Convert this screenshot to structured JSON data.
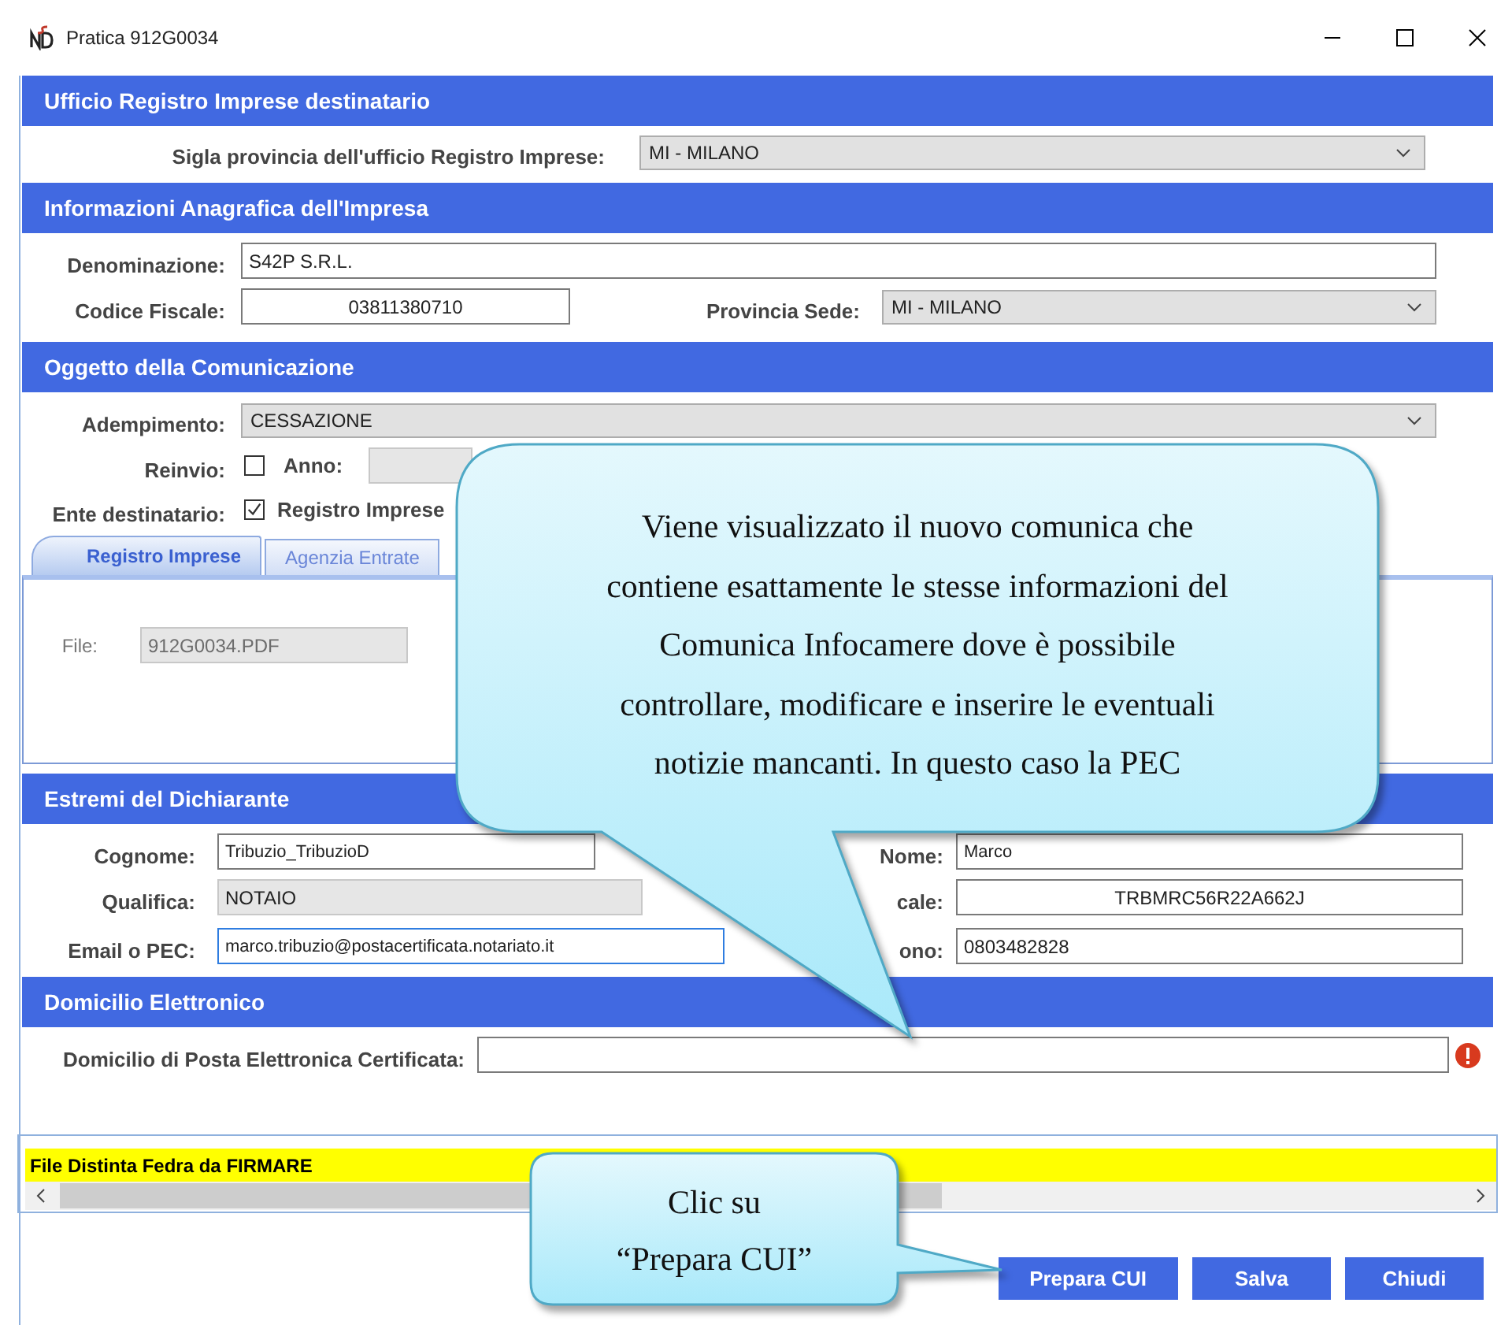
{
  "window": {
    "title": "Pratica 912G0034"
  },
  "ufficio": {
    "heading": "Ufficio Registro Imprese destinatario",
    "sigla": {
      "label": "Sigla provincia dell'ufficio Registro Imprese:",
      "value": "MI - MILANO"
    }
  },
  "anagrafica": {
    "heading": "Informazioni Anagrafica dell'Impresa",
    "denominazione": {
      "label": "Denominazione:",
      "value": "S42P S.R.L."
    },
    "codice_fiscale": {
      "label": "Codice Fiscale:",
      "value": "03811380710"
    },
    "provincia_sede": {
      "label": "Provincia Sede:",
      "value": "MI - MILANO"
    }
  },
  "oggetto": {
    "heading": "Oggetto della Comunicazione",
    "adempimento": {
      "label": "Adempimento:",
      "value": "CESSAZIONE"
    },
    "reinvio": {
      "label": "Reinvio:",
      "checked": false
    },
    "anno": {
      "label": "Anno:"
    },
    "ente": {
      "label": "Ente destinatario:",
      "option": {
        "label": "Registro Imprese",
        "checked": true
      }
    },
    "tabs": [
      {
        "label": "Registro Imprese",
        "selected": true
      },
      {
        "label": "Agenzia Entrate",
        "selected": false
      }
    ],
    "file": {
      "label": "File:",
      "value": "912G0034.PDF",
      "disabled": true
    }
  },
  "dichiarante": {
    "heading": "Estremi del Dichiarante",
    "cognome": {
      "label": "Cognome:",
      "value": "Tribuzio_TribuzioD"
    },
    "qualifica": {
      "label": "Qualifica:",
      "value": "NOTAIO"
    },
    "email": {
      "label": "Email o PEC:",
      "value": "marco.tribuzio@postacertificata.notariato.it"
    },
    "nome": {
      "label": "Nome:",
      "value": "Marco"
    },
    "codice_fiscale": {
      "label": "cale:",
      "value": "TRBMRC56R22A662J"
    },
    "telefono": {
      "label": "ono:",
      "value": "0803482828"
    }
  },
  "domicilio": {
    "heading": "Domicilio Elettronico",
    "pec": {
      "label": "Domicilio di Posta Elettronica Certificata:",
      "error": true
    }
  },
  "grid": {
    "rows": [
      "File Distinta Fedra da FIRMARE"
    ]
  },
  "buttons": [
    "Prepara CUI",
    "Salva",
    "Chiudi"
  ],
  "callouts": [
    {
      "lines": [
        "Viene visualizzato il nuovo comunica che",
        "contiene esattamente le stesse informazioni del",
        "Comunica Infocamere dove è possibile",
        "controllare, modificare e inserire le eventuali",
        "notizie mancanti. In questo caso la PEC"
      ]
    },
    {
      "lines": [
        "Clic su",
        "“Prepara CUI”"
      ]
    }
  ]
}
